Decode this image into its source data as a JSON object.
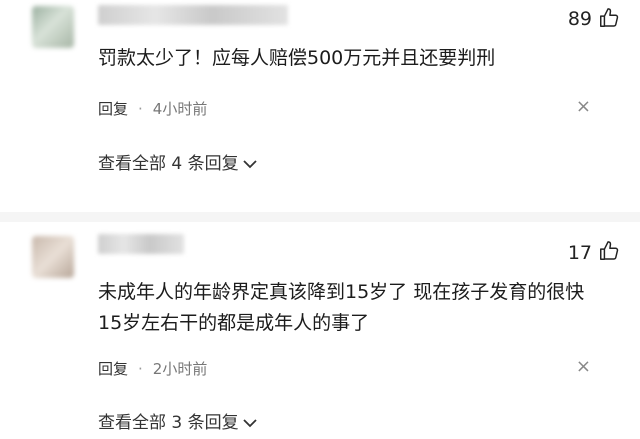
{
  "comments": [
    {
      "likes": "89",
      "text": "罚款太少了！应每人赔偿500万元并且还要判刑",
      "reply_label": "回复",
      "separator": "·",
      "time": "4小时前",
      "close": "×",
      "expand_label": "查看全部 4 条回复"
    },
    {
      "likes": "17",
      "text": "未成年人的年龄界定真该降到15岁了 现在孩子发育的很快 15岁左右干的都是成年人的事了",
      "reply_label": "回复",
      "separator": "·",
      "time": "2小时前",
      "close": "×",
      "expand_label": "查看全部 3 条回复"
    }
  ],
  "icons": {
    "like": "thumbs-up-icon",
    "expand": "chevron-down-icon",
    "close": "close-icon"
  }
}
